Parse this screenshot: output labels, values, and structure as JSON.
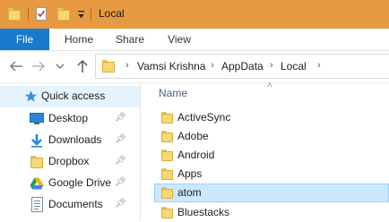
{
  "window": {
    "title": "Local",
    "accent_color": "#e79a42"
  },
  "ribbon": {
    "tabs": [
      {
        "label": "File"
      },
      {
        "label": "Home"
      },
      {
        "label": "Share"
      },
      {
        "label": "View"
      }
    ],
    "file_color": "#1979ca"
  },
  "address": {
    "breadcrumbs": [
      "Vamsi Krishna",
      "AppData",
      "Local"
    ]
  },
  "nav_pane": {
    "items": [
      {
        "label": "Quick access",
        "icon": "star-icon",
        "pinned": false
      },
      {
        "label": "Desktop",
        "icon": "desktop-icon",
        "pinned": true
      },
      {
        "label": "Downloads",
        "icon": "download-icon",
        "pinned": true
      },
      {
        "label": "Dropbox",
        "icon": "folder-icon",
        "pinned": true
      },
      {
        "label": "Google Drive",
        "icon": "google-drive-icon",
        "pinned": true
      },
      {
        "label": "Documents",
        "icon": "documents-icon",
        "pinned": true
      }
    ]
  },
  "content": {
    "column_header": "Name",
    "items": [
      {
        "name": "ActiveSync",
        "selected": false
      },
      {
        "name": "Adobe",
        "selected": false
      },
      {
        "name": "Android",
        "selected": false
      },
      {
        "name": "Apps",
        "selected": false
      },
      {
        "name": "atom",
        "selected": true
      },
      {
        "name": "Bluestacks",
        "selected": false
      }
    ]
  }
}
